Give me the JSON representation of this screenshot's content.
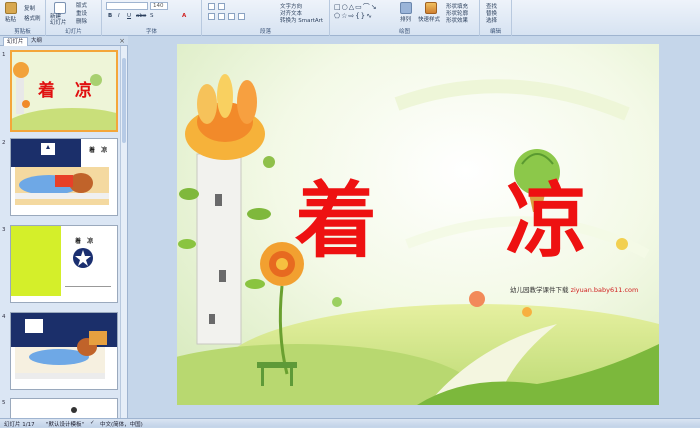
{
  "ribbon": {
    "groups": {
      "clipboard": "剪贴板",
      "slides": "幻灯片",
      "font": "字体",
      "paragraph": "段落",
      "drawing": "绘图",
      "editing": "编辑"
    },
    "paste": "粘贴",
    "copy": "复制",
    "format_painter": "格式刷",
    "new_slide": "新建\n幻灯片",
    "layout": "版式",
    "reset": "重设",
    "delete": "删除",
    "font_size": "140",
    "text_direction": "文字方向",
    "align_text": "对齐文本",
    "smartart": "转换为 SmartArt",
    "arrange": "排列",
    "quick_styles": "快速样式",
    "shape_fill": "形状填充",
    "shape_outline": "形状轮廓",
    "shape_effects": "形状效果",
    "find": "查找",
    "replace": "替换",
    "select": "选择"
  },
  "panel": {
    "tab_slides": "幻灯片",
    "tab_outline": "大纲",
    "close": "×",
    "slide_numbers": [
      "1",
      "2",
      "3",
      "4",
      "5"
    ],
    "thumb2_title": "着 凉",
    "thumb3_title": "着 凉"
  },
  "slide": {
    "title": "着 凉",
    "watermark_prefix": "幼儿园教学课件下载",
    "watermark_url": "ziyuan.baby611.com"
  },
  "status": {
    "slide_count": "幻灯片 1/17",
    "theme": "\"默认设计模板\"",
    "language": "中文(简体，中国)"
  },
  "colors": {
    "title": "#ee1111",
    "accent": "#f4a63a"
  }
}
